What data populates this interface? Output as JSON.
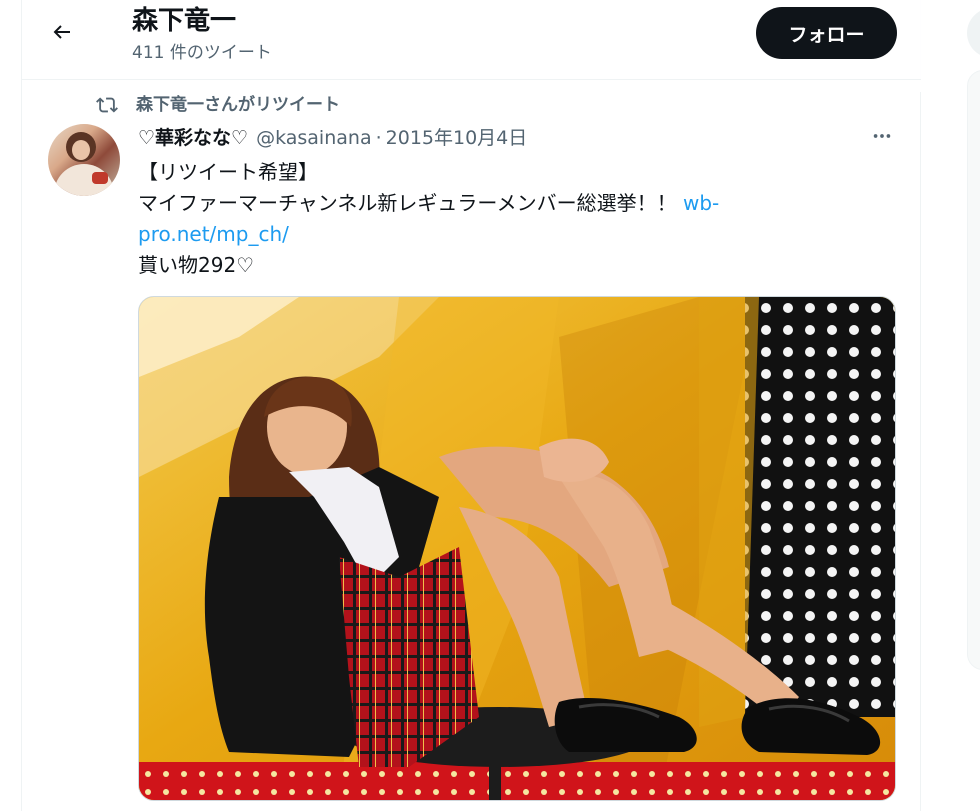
{
  "header": {
    "title": "森下竜一",
    "tweet_count": "411 件のツイート",
    "follow_label": "フォロー"
  },
  "retweet": {
    "text": "森下竜一さんがリツイート"
  },
  "tweet": {
    "author_name": "♡華彩なな♡",
    "handle": "@kasainana",
    "separator": "·",
    "date": "2015年10月4日",
    "lines": {
      "l1": "【リツイート希望】",
      "l2_text": "マイファーマーチャンネル新レギュラーメンバー総選挙！！ ",
      "l2_link": "wb-",
      "l3_link": "pro.net/mp_ch/",
      "l4": "貰い物292♡"
    },
    "media_alt": "photo"
  },
  "icons": {
    "back": "arrow-left-icon",
    "retweet": "retweet-icon",
    "more": "more-horizontal-icon"
  },
  "colors": {
    "text": "#0f1419",
    "secondary": "#536471",
    "link": "#1d9bf0",
    "follow_bg": "#0f1419",
    "border": "#eff3f4"
  }
}
